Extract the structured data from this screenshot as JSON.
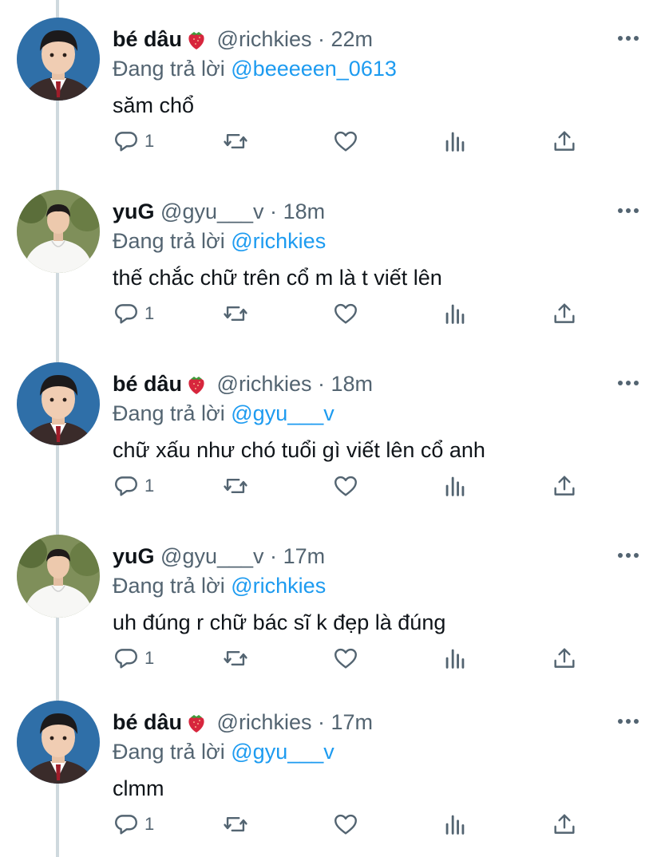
{
  "tweets": [
    {
      "name": "bé dâu",
      "handle": "@richkies",
      "time": "22m",
      "reply_prefix": "Đang trả lời ",
      "reply_to": "@beeeeen_0613",
      "text": "săm chổ",
      "reply_count": "1",
      "avatar": "avatar-boy-school-uniform"
    },
    {
      "name": "yuG",
      "handle": "@gyu___v",
      "time": "18m",
      "reply_prefix": "Đang trả lời ",
      "reply_to": "@richkies",
      "text": "thế chắc chữ trên cổ m là t viết lên",
      "reply_count": "1",
      "avatar": "avatar-boy-white-shirt"
    },
    {
      "name": "bé dâu",
      "handle": "@richkies",
      "time": "18m",
      "reply_prefix": "Đang trả lời ",
      "reply_to": "@gyu___v",
      "text": "chữ xấu như chó tuổi gì viết lên cổ anh",
      "reply_count": "1",
      "avatar": "avatar-boy-school-uniform"
    },
    {
      "name": "yuG",
      "handle": "@gyu___v",
      "time": "17m",
      "reply_prefix": "Đang trả lời ",
      "reply_to": "@richkies",
      "text": "uh đúng r chữ bác sĩ k đẹp là đúng",
      "reply_count": "1",
      "avatar": "avatar-boy-white-shirt"
    },
    {
      "name": "bé dâu",
      "handle": "@richkies",
      "time": "17m",
      "reply_prefix": "Đang trả lời ",
      "reply_to": "@gyu___v",
      "text": "clmm",
      "reply_count": "1",
      "avatar": "avatar-boy-school-uniform"
    }
  ],
  "separator": "·",
  "icons": {
    "name_emoji": "strawberry-icon",
    "more": "more-dots-icon",
    "reply": "reply-icon",
    "retweet": "retweet-icon",
    "like": "heart-icon",
    "stats": "stats-icon",
    "share": "share-icon"
  },
  "colors": {
    "link": "#1d9bf0",
    "secondary": "#536471",
    "text": "#0f1419",
    "thread_line": "#cfd9de"
  }
}
